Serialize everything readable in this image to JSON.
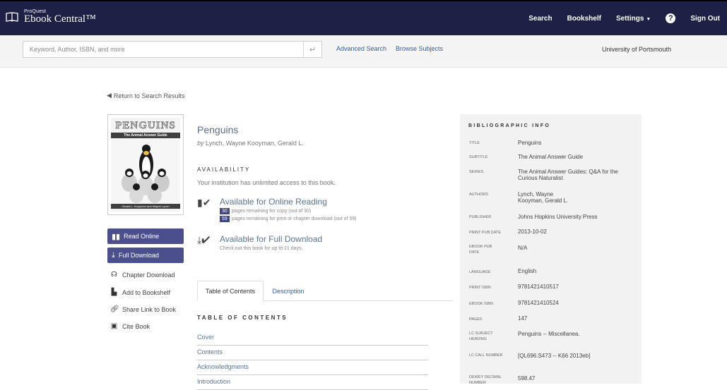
{
  "header": {
    "brand_small": "ProQuest",
    "brand_big": "Ebook Central™",
    "nav": {
      "search": "Search",
      "bookshelf": "Bookshelf",
      "settings": "Settings",
      "help": "?",
      "signout": "Sign Out"
    }
  },
  "search": {
    "placeholder": "Keyword, Author, ISBN, and more",
    "enter_icon": "↵",
    "advanced": "Advanced Search",
    "browse": "Browse Subjects",
    "institution": "University of Portsmouth"
  },
  "return_link": "Return to Search Results",
  "cover": {
    "title": "PENGUINS",
    "subtitle": "The Animal Answer Guide",
    "author": "Gerald L. Kooyman and Wayne Lynch"
  },
  "sidebar": {
    "read_online": "Read Online",
    "full_download": "Full Download",
    "chapter_download": "Chapter Download",
    "add_bookshelf": "Add to Bookshelf",
    "share_link": "Share Link to Book",
    "cite_book": "Cite Book"
  },
  "book": {
    "title": "Penguins",
    "by": "by",
    "authors": "Lynch, Wayne Kooyman, Gerald L."
  },
  "availability": {
    "heading": "AVAILABILITY",
    "description": "Your institution has unlimited access to this book.",
    "online": {
      "label": "Available for Online Reading",
      "copy_count": "30",
      "copy_text": "pages remaining for copy (out of 30)",
      "print_count": "59",
      "print_text": "pages remaining for print or chapter download (out of 59)"
    },
    "download": {
      "label": "Available for Full Download",
      "text": "Check out this book for up to 21 days."
    }
  },
  "tabs": {
    "toc": "Table of Contents",
    "description": "Description"
  },
  "toc": {
    "heading": "TABLE OF CONTENTS",
    "items": [
      "Cover",
      "Contents",
      "Acknowledgments",
      "Introduction"
    ]
  },
  "biblio": {
    "heading": "BIBLIOGRAPHIC INFO",
    "rows": [
      {
        "label": "TITLE",
        "value": "Penguins"
      },
      {
        "label": "SUBTITLE",
        "value": "The Animal Answer Guide"
      },
      {
        "label": "SERIES",
        "value": "The Animal Answer Guides: Q&A for the Curious Naturalist"
      },
      {
        "label": "AUTHORS",
        "value": "Lynch, Wayne\nKooyman, Gerald L."
      },
      {
        "label": "PUBLISHER",
        "value": "Johns Hopkins University Press"
      },
      {
        "label": "PRINT PUB DATE",
        "value": "2013-10-02"
      },
      {
        "label": "EBOOK PUB DATE",
        "value": "N/A"
      },
      {
        "label": "LANGUAGE",
        "value": "English"
      },
      {
        "label": "PRINT ISBN",
        "value": "9781421410517"
      },
      {
        "label": "EBOOK ISBN",
        "value": "9781421410524"
      },
      {
        "label": "PAGES",
        "value": "147"
      },
      {
        "label": "LC SUBJECT HEADING",
        "value": "Penguins -- Miscellanea."
      },
      {
        "label": "LC CALL NUMBER",
        "value": "[QL696.S473 -- K66 2013eb]"
      },
      {
        "label": "DEWEY DECIMAL NUMBER",
        "value": "598.47"
      }
    ]
  },
  "colors": {
    "navbar": "#1c2145",
    "button": "#4c4f8e",
    "link": "#2a61b0"
  }
}
